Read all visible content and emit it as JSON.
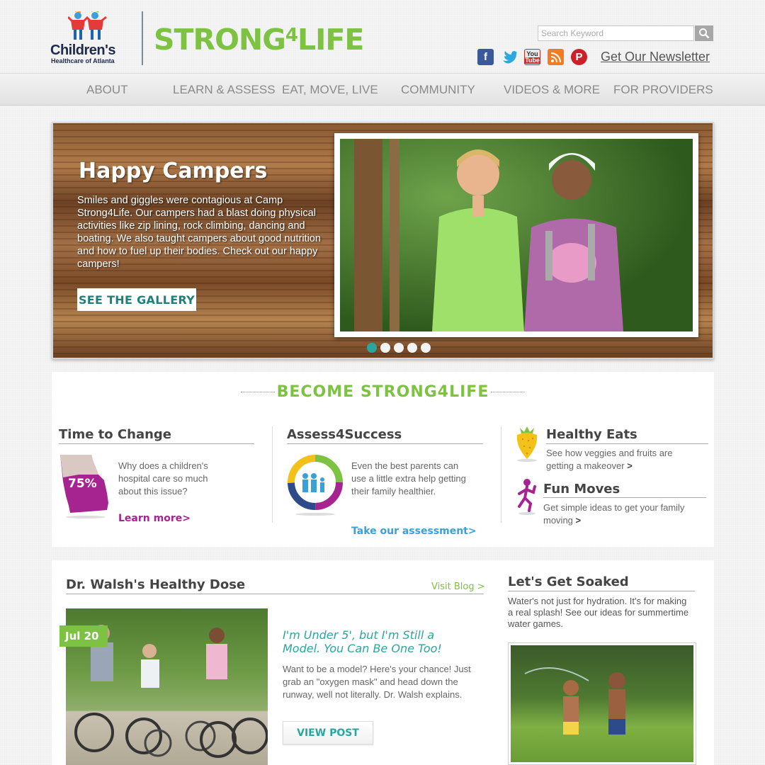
{
  "header": {
    "org_name": "Children's",
    "org_sub": "Healthcare of Atlanta",
    "brand": "STRONG",
    "brand_four": "4",
    "brand_end": "LIFE",
    "search_placeholder": "Search Keyword",
    "newsletter": "Get Our Newsletter",
    "social": [
      "facebook-icon",
      "twitter-icon",
      "youtube-icon",
      "blog-icon",
      "pinterest-icon"
    ]
  },
  "nav": {
    "items": [
      "ABOUT",
      "LEARN & ASSESS",
      "EAT, MOVE, LIVE",
      "COMMUNITY",
      "VIDEOS & MORE",
      "FOR PROVIDERS"
    ]
  },
  "hero": {
    "title": "Happy Campers",
    "text": "Smiles and giggles were contagious  at Camp Strong4Life. Our campers had a blast doing physical activities like zip lining, rock climbing, dancing and boating. We also taught campers about good nutrition and how to fuel up their bodies. Check out our happy campers!",
    "button": "SEE THE GALLERY",
    "slide_count": 5,
    "active_slide": 1
  },
  "become": {
    "title": "BECOME STRONG4LIFE",
    "time_to_change": {
      "title": "Time to Change",
      "stat": "75%",
      "text": "Why does a children's hospital care so much about this issue?",
      "link": "Learn more>"
    },
    "assess": {
      "title": "Assess4Success",
      "text": "Even the best parents can use a little extra help getting their family healthier.",
      "link": "Take our assessment>"
    },
    "healthy_eats": {
      "title": "Healthy Eats",
      "text": "See how veggies and fruits are getting a makeover",
      "arrow": ">"
    },
    "fun_moves": {
      "title": "Fun Moves",
      "text": "Get simple ideas to get your family moving",
      "arrow": ">"
    }
  },
  "blog": {
    "title": "Dr. Walsh's Healthy Dose",
    "visit": "Visit Blog >",
    "date": "Jul 20",
    "post_title": "I'm Under 5', but I'm Still a Model. You Can Be One Too!",
    "post_text": "Want to be a model? Here's your chance! Just grab an \"oxygen mask\" and head down the runway, well not literally. Dr. Walsh explains.",
    "button": "VIEW POST"
  },
  "soaked": {
    "title": "Let's Get Soaked",
    "text": "Water's not just for hydration. It's for making a real splash! See our ideas for summertime water games."
  },
  "colors": {
    "brand_green": "#7dc242",
    "teal": "#2aa6a0",
    "magenta": "#a6248f",
    "link_blue": "#3aa0d8"
  }
}
